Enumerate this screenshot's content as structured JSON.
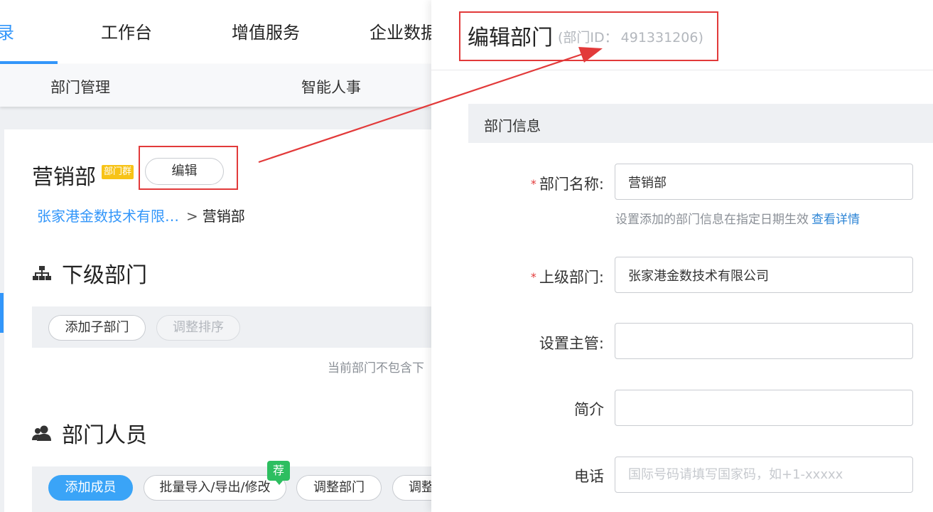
{
  "topnav": {
    "items": [
      {
        "label": "录",
        "active": true
      },
      {
        "label": "工作台",
        "active": false
      },
      {
        "label": "增值服务",
        "active": false
      },
      {
        "label": "企业数据",
        "active": false
      }
    ]
  },
  "subnav": {
    "items": [
      "部门管理",
      "智能人事"
    ]
  },
  "department": {
    "name": "营销部",
    "badge": "部门群",
    "edit_label": "编辑",
    "breadcrumb": {
      "company": "张家港金数技术有限…",
      "separator": ">",
      "current": "营销部"
    }
  },
  "sub_departments": {
    "title": "下级部门",
    "buttons": {
      "add_child": "添加子部门",
      "sort": "调整排序"
    },
    "empty_note": "当前部门不包含下"
  },
  "members": {
    "title": "部门人员",
    "buttons": {
      "add_member": "添加成员",
      "batch": "批量导入/导出/修改",
      "adjust_dept": "调整部门",
      "adjust_more": "调整"
    },
    "recommend_badge": "荐"
  },
  "drawer": {
    "title": "编辑部门",
    "id_label": "(部门ID：",
    "id_value": "491331206)",
    "section": "部门信息",
    "fields": {
      "name": {
        "label": "部门名称:",
        "required": true,
        "value": "营销部"
      },
      "hint": {
        "text": "设置添加的部门信息在指定日期生效",
        "link": "查看详情"
      },
      "parent": {
        "label": "上级部门:",
        "required": true,
        "value": "张家港金数技术有限公司"
      },
      "manager": {
        "label": "设置主管:",
        "required": false,
        "value": ""
      },
      "intro": {
        "label": "简介",
        "required": false,
        "value": ""
      },
      "phone": {
        "label": "电话",
        "required": false,
        "value": "",
        "placeholder": "国际号码请填写国家码，如+1-xxxxx"
      }
    },
    "required_mark": "*"
  },
  "colors": {
    "accent": "#3296fa",
    "annotation_red": "#e23a3a",
    "badge_yellow": "#f7c317",
    "recommend_green": "#2dbe60"
  },
  "icons": {
    "sub_departments": "org-chart-icon",
    "members": "users-icon"
  }
}
